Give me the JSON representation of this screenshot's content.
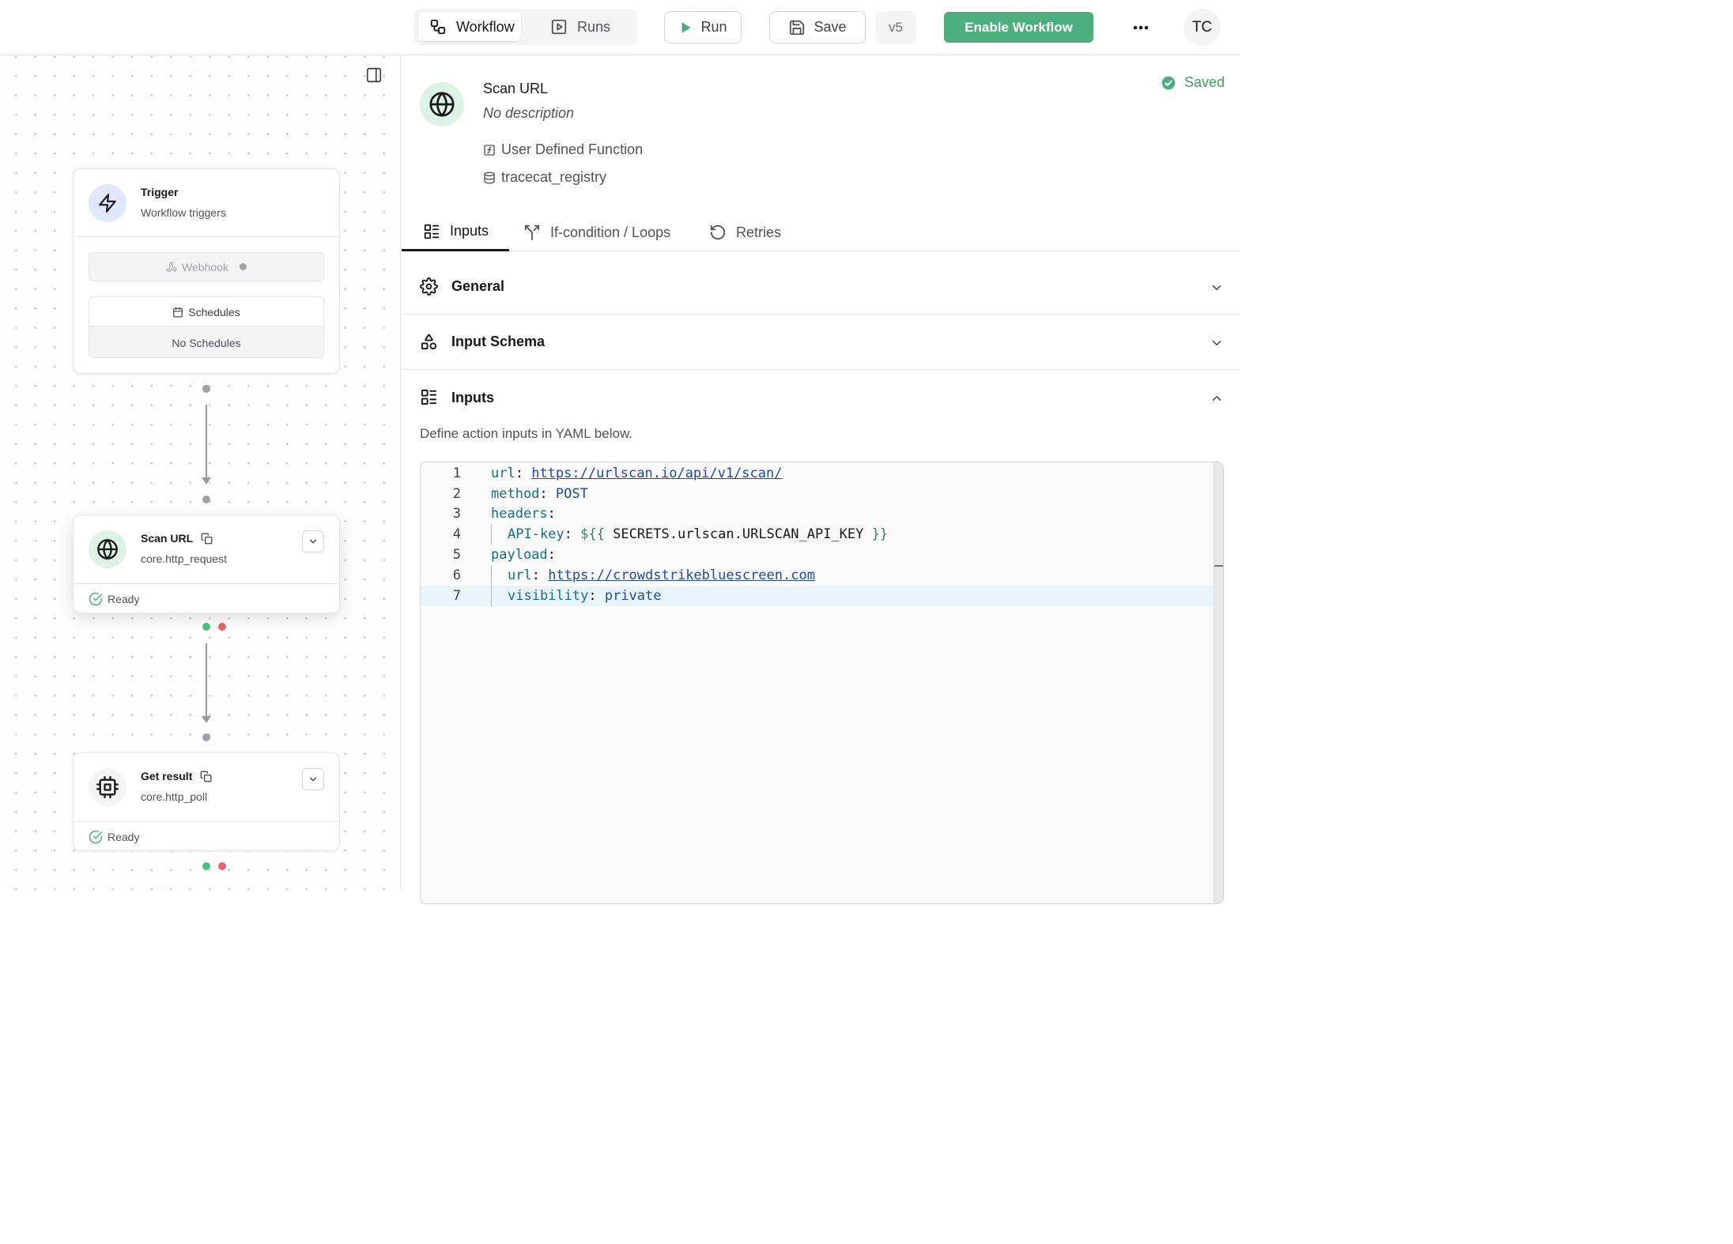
{
  "topbar": {
    "tabs": [
      {
        "label": "Workflow",
        "icon": "workflow-icon",
        "active": true
      },
      {
        "label": "Runs",
        "icon": "play-square-icon",
        "active": false
      }
    ],
    "run_label": "Run",
    "save_label": "Save",
    "version": "v5",
    "enable_label": "Enable Workflow",
    "avatar_initials": "TC"
  },
  "canvas": {
    "trigger": {
      "title": "Trigger",
      "subtitle": "Workflow triggers",
      "webhook_label": "Webhook",
      "schedules_label": "Schedules",
      "schedules_empty": "No Schedules"
    },
    "nodes": [
      {
        "title": "Scan URL",
        "subtitle": "core.http_request",
        "status": "Ready",
        "icon": "globe-icon"
      },
      {
        "title": "Get result",
        "subtitle": "core.http_poll",
        "status": "Ready",
        "icon": "cpu-icon"
      }
    ]
  },
  "panel": {
    "title": "Scan URL",
    "description": "No description",
    "type": "User Defined Function",
    "namespace": "tracecat_registry",
    "status": "Saved",
    "tabs": [
      {
        "label": "Inputs",
        "active": true
      },
      {
        "label": "If-condition / Loops",
        "active": false
      },
      {
        "label": "Retries",
        "active": false
      }
    ],
    "sections": {
      "general": "General",
      "input_schema": "Input Schema",
      "inputs": "Inputs"
    },
    "inputs_hint": "Define action inputs in YAML below.",
    "code_lines": [
      {
        "num": "1",
        "key": "url",
        "value": "https://urlscan.io/api/v1/scan/"
      },
      {
        "num": "2",
        "key": "method",
        "value": "POST"
      },
      {
        "num": "3",
        "key": "headers",
        "value": ""
      },
      {
        "num": "4",
        "key": "API-key",
        "template_open": "${{",
        "expr": " SECRETS.urlscan.URLSCAN_API_KEY ",
        "template_close": "}}"
      },
      {
        "num": "5",
        "key": "payload",
        "value": ""
      },
      {
        "num": "6",
        "key": "url",
        "value": "https://crowdstrikebluescreen.com"
      },
      {
        "num": "7",
        "key": "visibility",
        "value": "private"
      }
    ]
  },
  "colors": {
    "accent_green": "#4caf7d",
    "saved_green": "#3f9f6a",
    "success_dot": "#4cbf7d",
    "error_dot": "#e5626e"
  }
}
